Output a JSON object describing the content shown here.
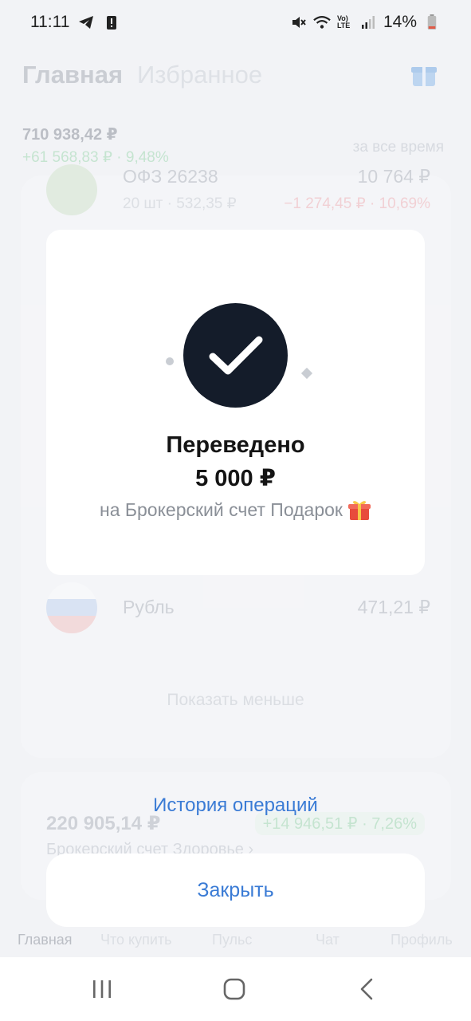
{
  "status_bar": {
    "time": "11:11",
    "battery": "14%",
    "network_label": "Vo) LTE"
  },
  "background": {
    "tab_main": "Главная",
    "tab_favorites": "Избранное",
    "total_value": "710 938,42 ₽",
    "total_change": "+61 568,83 ₽ · 9,48%",
    "period": "за все время",
    "asset_1": {
      "name": "ОФЗ 26238",
      "sub": "20 шт · 532,35 ₽",
      "value": "10 764 ₽",
      "change": "−1 274,45 ₽ · 10,69%"
    },
    "asset_ruble": {
      "name": "Рубль",
      "value": "471,21 ₽"
    },
    "show_less": "Показать меньше",
    "account_value": "220 905,14 ₽",
    "account_change": "+14 946,51 ₽ · 7,26%",
    "account_name": "Брокерский счет Здоровье ›",
    "nav": {
      "home": "Главная",
      "what_to_buy": "Что купить",
      "pulse": "Пульс",
      "chat": "Чат",
      "profile": "Профиль"
    }
  },
  "modal": {
    "title": "Переведено",
    "amount": "5 000 ₽",
    "description": "на Брокерский счет Подарок",
    "icon": "check-icon"
  },
  "actions": {
    "history_label": "История операций",
    "close_label": "Закрыть"
  },
  "colors": {
    "accent_blue": "#3a7bd5",
    "success_circle": "#141c2a"
  }
}
